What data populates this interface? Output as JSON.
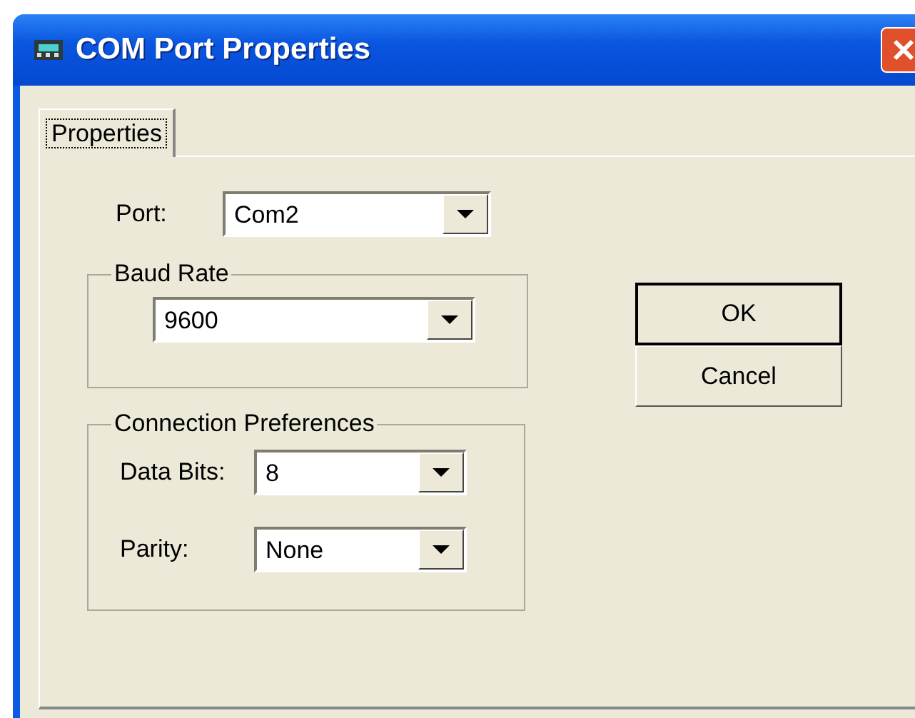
{
  "window": {
    "title": "COM Port Properties"
  },
  "tabs": [
    {
      "label": "Properties",
      "selected": true
    }
  ],
  "port": {
    "label": "Port:",
    "value": "Com2"
  },
  "baud_rate": {
    "title": "Baud Rate",
    "value": "9600"
  },
  "connection_preferences": {
    "title": "Connection Preferences",
    "fields": [
      {
        "label": "Data Bits:",
        "value": "8"
      },
      {
        "label": "Parity:",
        "value": "None"
      }
    ]
  },
  "buttons": [
    {
      "label": "OK",
      "default": true
    },
    {
      "label": "Cancel",
      "default": false
    }
  ]
}
